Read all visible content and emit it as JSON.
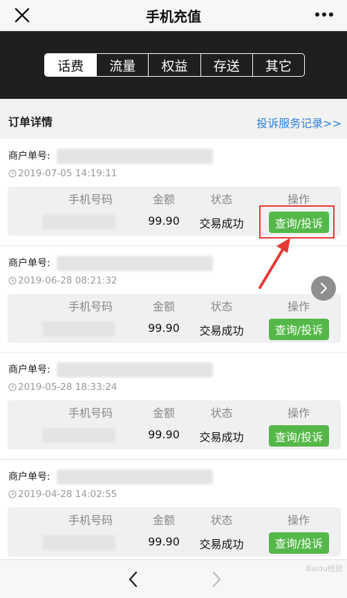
{
  "header": {
    "title": "手机充值"
  },
  "tabs": [
    "话费",
    "流量",
    "权益",
    "存送",
    "其它"
  ],
  "section": {
    "title": "订单详情",
    "complaint_link": "投诉服务记录>>"
  },
  "columns": {
    "phone": "手机号码",
    "amount": "金额",
    "status": "状态",
    "action": "操作"
  },
  "merchant_label": "商户单号:",
  "orders": [
    {
      "time": "2019-07-05 14:19:11",
      "amount": "99.90",
      "status": "交易成功",
      "action": "查询/投诉"
    },
    {
      "time": "2019-06-28 08:21:32",
      "amount": "99.90",
      "status": "交易成功",
      "action": "查询/投诉"
    },
    {
      "time": "2019-05-28 18:33:24",
      "amount": "99.90",
      "status": "交易成功",
      "action": "查询/投诉"
    },
    {
      "time": "2019-04-28 14:02:55",
      "amount": "99.90",
      "status": "交易成功",
      "action": "查询/投诉"
    }
  ],
  "watermark": "Baidu经验",
  "icons": [
    "close-icon",
    "more-icon",
    "clock-icon",
    "chevron-right-icon",
    "back-icon",
    "forward-icon",
    "red-arrow"
  ],
  "colors": {
    "accent_green": "#54b848",
    "link_blue": "#2f7ed8",
    "highlight_red": "#e53935",
    "banner_dark": "#1f1f1f"
  }
}
